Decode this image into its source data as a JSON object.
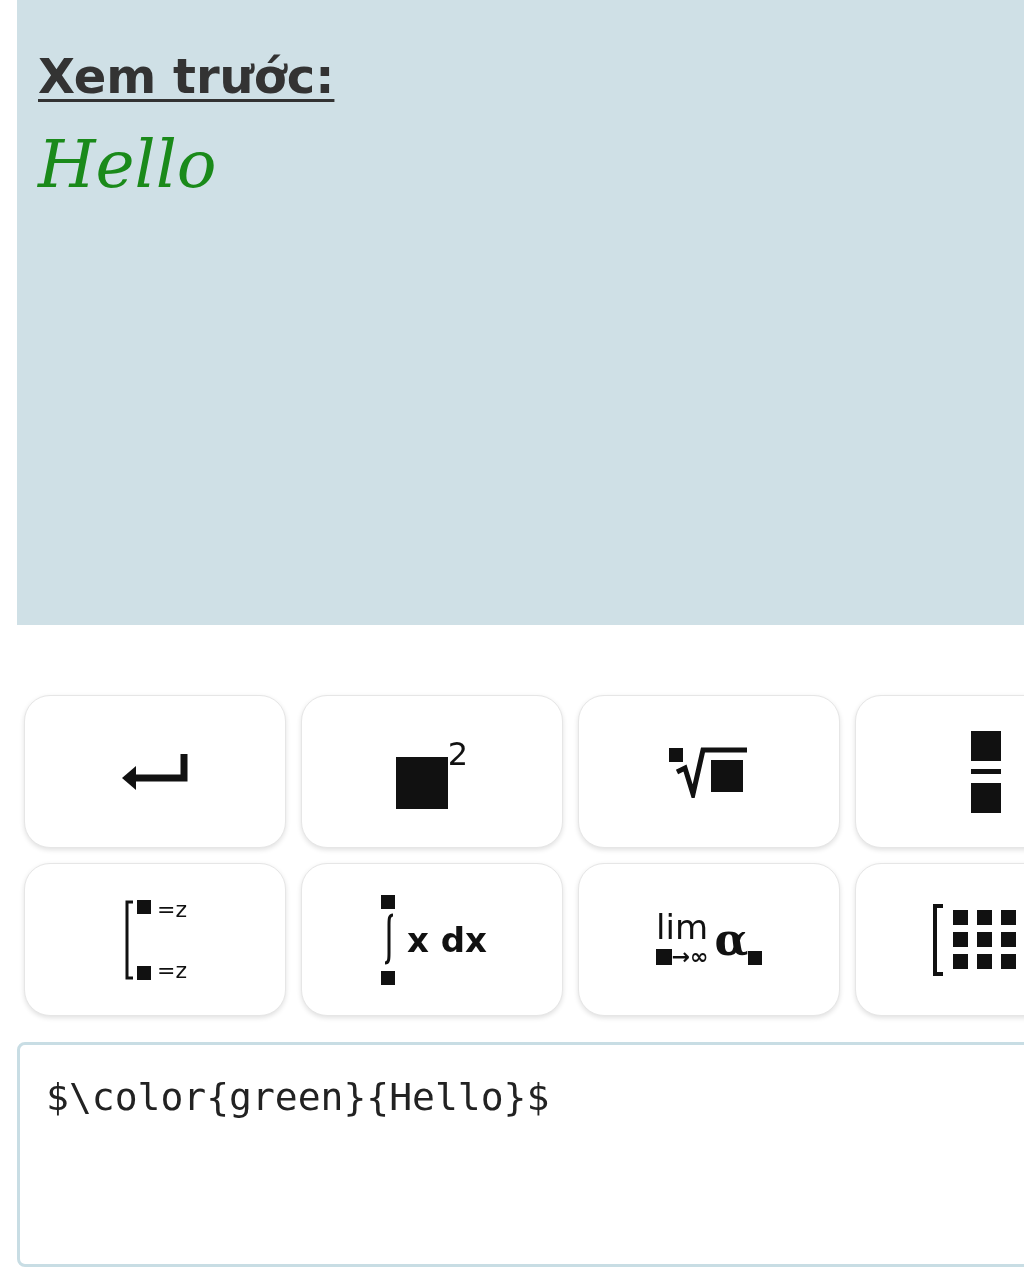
{
  "preview": {
    "heading": "Xem trước:",
    "content": "Hello",
    "color": "#1a8a1a"
  },
  "buttons": [
    {
      "kind": "enter"
    },
    {
      "kind": "power",
      "text": "2"
    },
    {
      "kind": "root"
    },
    {
      "kind": "fraction"
    },
    {
      "kind": "bounds",
      "upper": "=z",
      "lower": "=z"
    },
    {
      "kind": "integral",
      "text": "x dx"
    },
    {
      "kind": "limit",
      "text": "lim",
      "sub": "→∞",
      "symbol": "α"
    },
    {
      "kind": "matrix"
    }
  ],
  "editor": {
    "value": "$\\color{green}{Hello}$"
  }
}
